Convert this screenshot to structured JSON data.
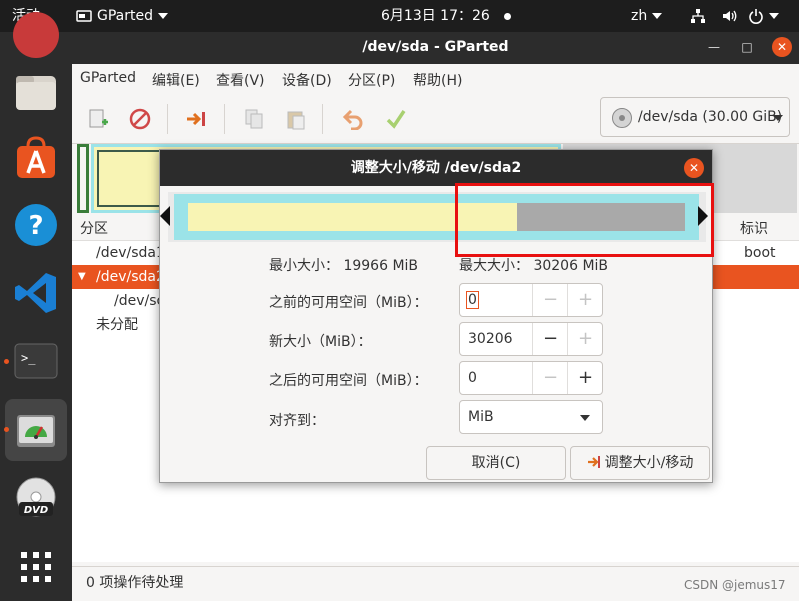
{
  "topbar": {
    "activities": "活动",
    "app_menu": "GParted",
    "clock": "6月13日  17：26",
    "input_method": "zh"
  },
  "dock": {
    "items": [
      "chrome-icon",
      "files-icon",
      "software-icon",
      "help-icon",
      "vscode-icon",
      "terminal-icon",
      "gparted-icon",
      "dvd-icon",
      "app-grid-icon"
    ]
  },
  "window": {
    "title": "/dev/sda - GParted",
    "menu": [
      "GParted",
      "编辑(E)",
      "查看(V)",
      "设备(D)",
      "分区(P)",
      "帮助(H)"
    ],
    "device_select": "/dev/sda (30.00 GiB)",
    "columns": {
      "partition": "分区",
      "flags": "标识"
    },
    "rows": [
      {
        "name": "/dev/sda1",
        "flags": "boot"
      },
      {
        "name": "/dev/sda2",
        "flags": ""
      },
      {
        "name": "/dev/sc",
        "flags": ""
      },
      {
        "name": "未分配",
        "flags": ""
      }
    ],
    "status": "0 项操作待处理"
  },
  "dialog": {
    "title": "调整大小/移动 /dev/sda2",
    "min_size_label": "最小大小：",
    "min_size": "19966 MiB",
    "max_size_label": "最大大小：",
    "max_size": "30206 MiB",
    "free_before_label": "之前的可用空间（MiB）：",
    "free_before": "0",
    "new_size_label": "新大小（MiB）：",
    "new_size": "30206",
    "free_after_label": "之后的可用空间（MiB）：",
    "free_after": "0",
    "align_label": "对齐到：",
    "align_value": "MiB",
    "cancel_label": "取消(C)",
    "resize_label": "调整大小/移动",
    "used_fraction": 0.661
  },
  "watermark": "CSDN @jemus17",
  "colors": {
    "accent": "#e95420",
    "partition_border": "#9be3e8",
    "used": "#f8f4b4",
    "unused": "#a9a9a9",
    "highlight_box": "#e81010"
  }
}
